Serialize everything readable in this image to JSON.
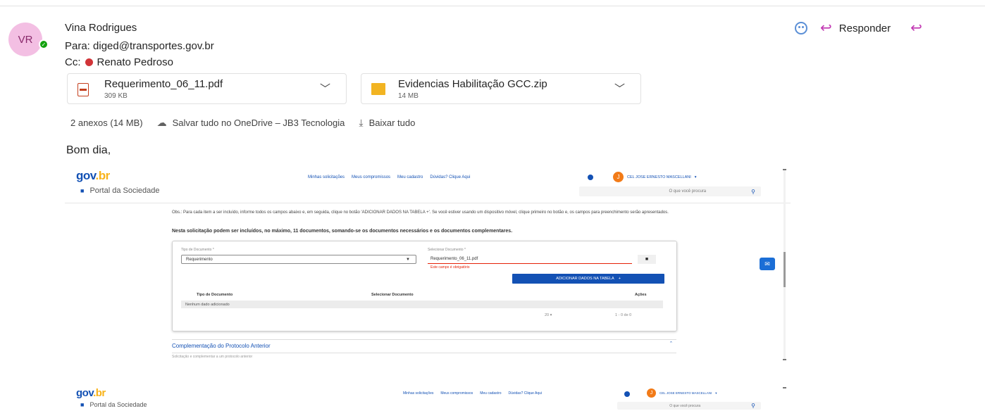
{
  "email": {
    "sender_initials": "VR",
    "sender_name": "Vina Rodrigues",
    "to_label": "Para:",
    "to_value": "diged@transportes.gov.br",
    "cc_label": "Cc:",
    "cc_value": "Renato Pedroso",
    "reply_label": "Responder",
    "greeting": "Bom dia,"
  },
  "attachments": [
    {
      "name": "Requerimento_06_11.pdf",
      "size": "309 KB",
      "icon": "pdf-icon"
    },
    {
      "name": "Evidencias Habilitação GCC.zip",
      "size": "14 MB",
      "icon": "zip-icon"
    }
  ],
  "attachment_summary": {
    "count": "2 anexos (14 MB)",
    "save": "Salvar tudo no OneDrive – JB3 Tecnologia",
    "download": "Baixar tudo"
  },
  "embedded": {
    "logo_a": "gov",
    "logo_b": ".br",
    "portal_name": "Portal da Sociedade",
    "top_links": [
      "Minhas solicitações",
      "Meus compromissos",
      "Meu cadastro",
      "Dúvidas? Clique Aqui"
    ],
    "user_initial": "J",
    "user_name": "CEL JOSE ERNESTO MASCELLANI",
    "search_placeholder": "O que você procura",
    "obs_text": "Obs.: Para cada item a ser incluído, informe todos os campos abaixo e, em seguida, clique no botão 'ADICIONAR DADOS NA TABELA +'. Se você estiver usando um dispositivo móvel, clique primeiro no botão e, os campos para preenchimento serão apresentados.",
    "limit_text": "Nesta solicitação podem ser incluídos, no máximo, 11 documentos, somando-se os documentos necessários e os documentos complementares.",
    "field_type_label": "Tipo de Documento *",
    "field_type_value": "Requerimento",
    "field_doc_label": "Selecionar Documento *",
    "field_doc_value": "Requerimento_06_11.pdf",
    "field_error": "Este campo é obrigatório",
    "add_button": "ADICIONAR DADOS NA TABELA",
    "col_type": "Tipo de Documento",
    "col_doc": "Selecionar Documento",
    "col_actions": "Ações",
    "no_data": "Nenhum dado adicionado",
    "page_size": "20",
    "page_info": "1 - 0 de 0",
    "section_title": "Complementação do Protocolo Anterior",
    "section_sub": "Solicitação e complementar a um protocolo anterior"
  }
}
